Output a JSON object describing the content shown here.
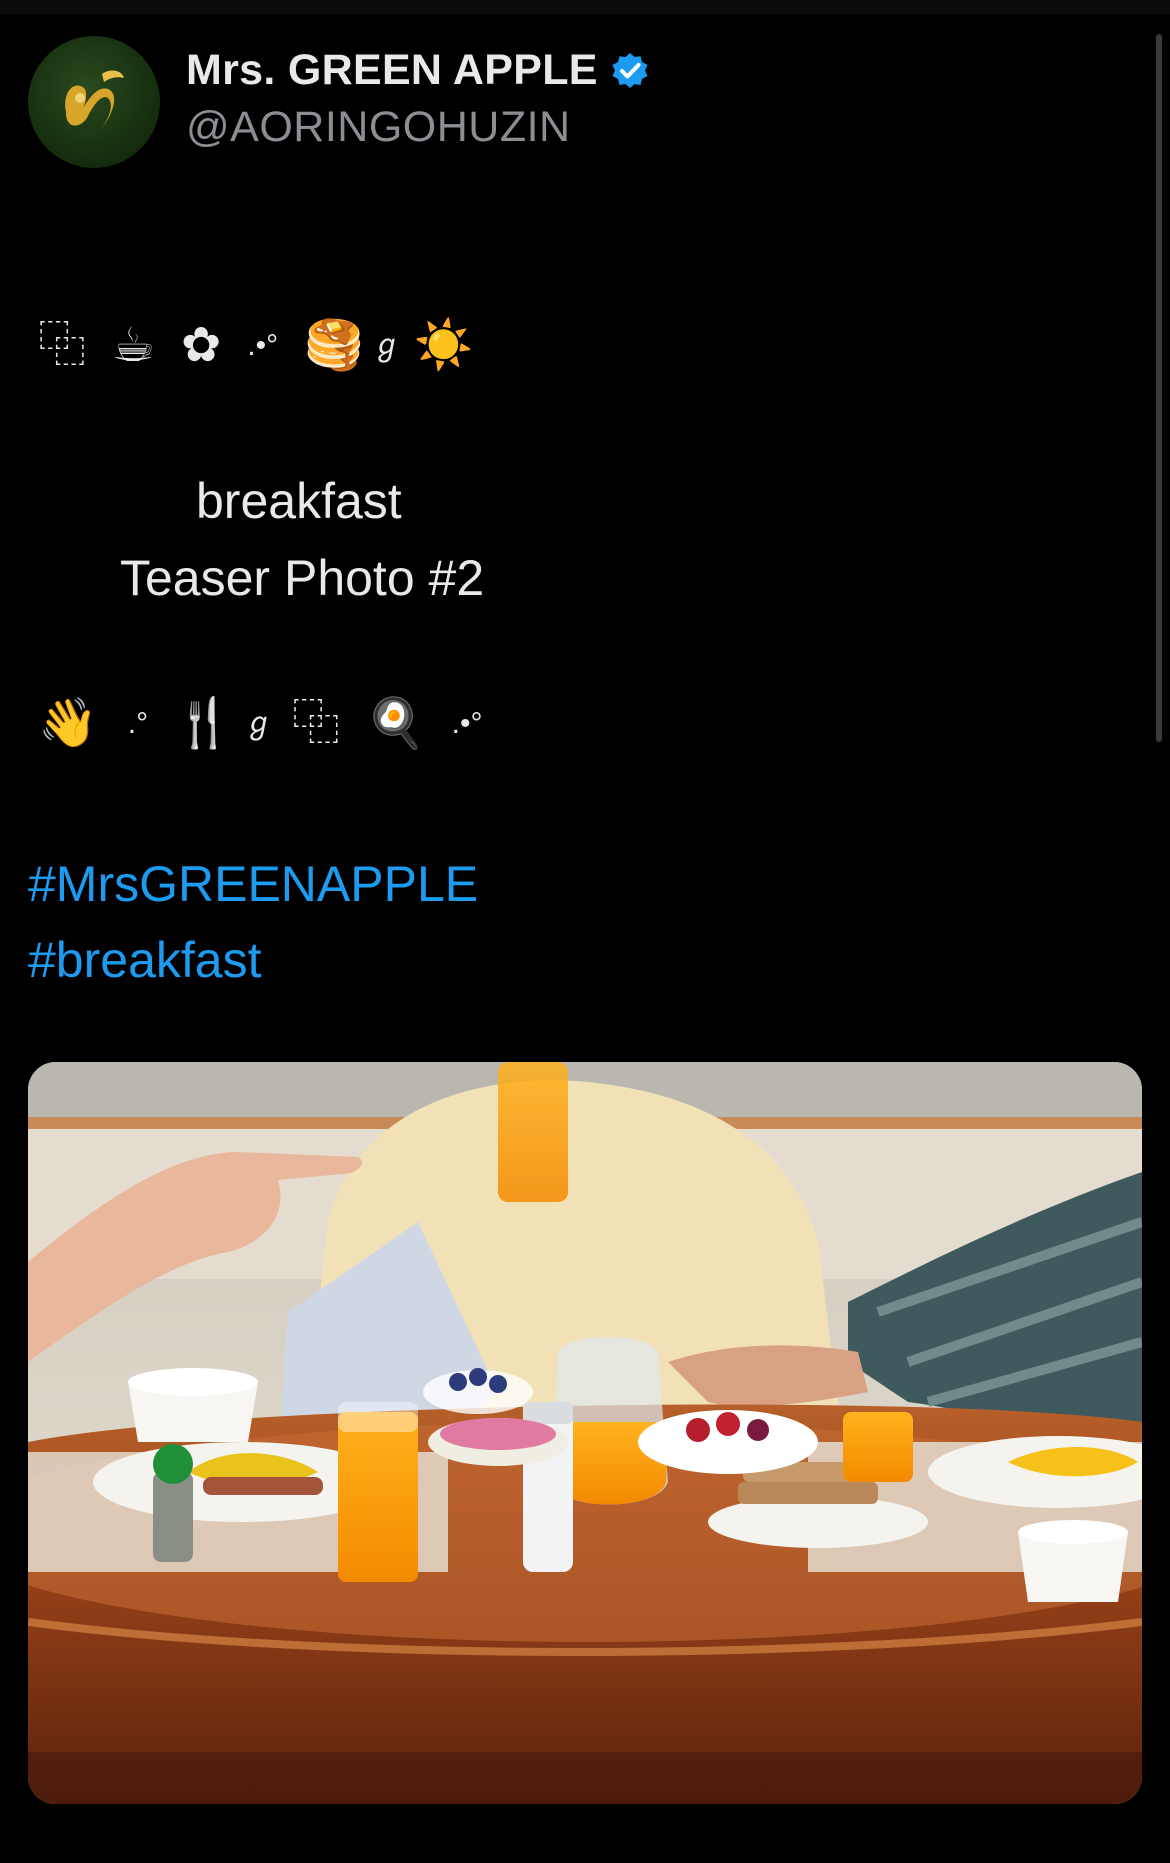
{
  "account": {
    "display_name": "Mrs. GREEN APPLE",
    "handle": "@AORINGOHUZIN",
    "verified": true,
    "verified_color": "#1d9bf0",
    "avatar_icon": "green-apple-logo-icon"
  },
  "tweet": {
    "emoji_row_1": [
      "⿻",
      "☕",
      "✿",
      ".•°",
      "🥞",
      "ℊ",
      "☀️"
    ],
    "title_line_1": "breakfast",
    "title_line_2": "Teaser Photo #2",
    "emoji_row_2": [
      "👋",
      ".°",
      "🍴",
      "ℊ",
      "⿻",
      "🍳",
      ".•°"
    ],
    "hashtags": [
      "#MrsGREENAPPLE",
      "#breakfast"
    ],
    "hashtag_color": "#1d9bf0"
  },
  "media": {
    "icon": "breakfast-table-photo"
  },
  "colors": {
    "background": "#000000",
    "text": "#e7e9ea",
    "secondary_text": "#8b8f94"
  }
}
